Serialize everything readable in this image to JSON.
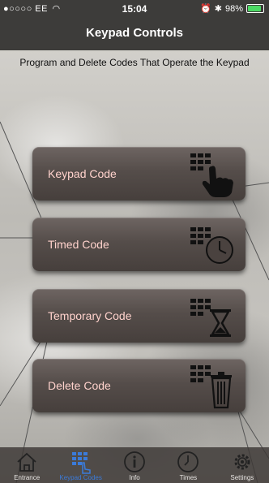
{
  "status": {
    "carrier": "●○○○○ EE",
    "time": "15:04",
    "battery": "98%",
    "battery_level": 0.98
  },
  "navbar": {
    "title": "Keypad Controls"
  },
  "subtitle": "Program and Delete Codes That Operate the Keypad",
  "buttons": [
    {
      "label": "Keypad Code",
      "icon": "keypad-touch-icon"
    },
    {
      "label": "Timed Code",
      "icon": "keypad-clock-icon"
    },
    {
      "label": "Temporary Code",
      "icon": "keypad-hourglass-icon"
    },
    {
      "label": "Delete Code",
      "icon": "keypad-trash-icon"
    }
  ],
  "tabs": [
    {
      "label": "Entrance",
      "icon": "house-icon",
      "active": false
    },
    {
      "label": "Keypad Codes",
      "icon": "keypad-icon",
      "active": true
    },
    {
      "label": "Info",
      "icon": "info-icon",
      "active": false
    },
    {
      "label": "Times",
      "icon": "clock-icon",
      "active": false
    },
    {
      "label": "Settings",
      "icon": "gear-icon",
      "active": false
    }
  ],
  "colors": {
    "bar": "#3d3c3a",
    "button_label": "#ffd2cc",
    "active_tab": "#3b7bd9"
  }
}
